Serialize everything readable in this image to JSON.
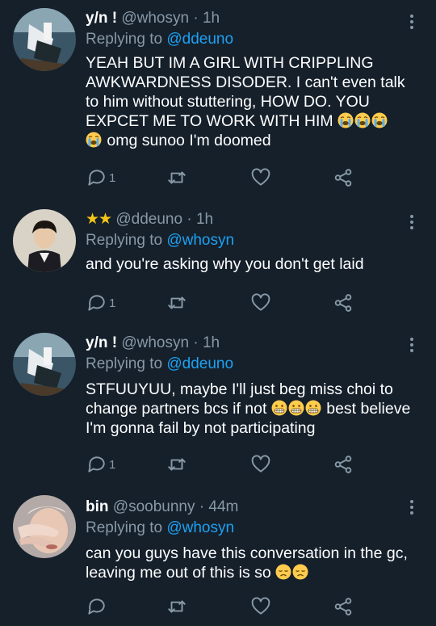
{
  "tweets": [
    {
      "name": "y/n !",
      "handle": "@whosyn",
      "separator": "·",
      "time": "1h",
      "replying_prefix": "Replying to",
      "replying_to": "@ddeuno",
      "text_parts": [
        "YEAH BUT IM A GIRL WITH CRIPPLING AWKWARDNESS DISODER. I can't even talk to him without stuttering, HOW DO. YOU EXPCET ME TO WORK WITH HIM",
        "omg sunoo I'm doomed"
      ],
      "emoji": [
        "loudly-crying-face",
        "loudly-crying-face",
        "loudly-crying-face",
        "loudly-crying-face"
      ],
      "reply_count": "1",
      "icons": {
        "reply": "reply-icon",
        "retweet": "retweet-icon",
        "like": "heart-icon",
        "share": "share-icon",
        "menu": "more-vertical-icon"
      }
    },
    {
      "name_stars": "★★",
      "handle": "@ddeuno",
      "separator": "·",
      "time": "1h",
      "replying_prefix": "Replying to",
      "replying_to": "@whosyn",
      "text_parts": [
        "and you're asking why you don't get laid"
      ],
      "emoji": [],
      "reply_count": "1",
      "icons": {
        "reply": "reply-icon",
        "retweet": "retweet-icon",
        "like": "heart-icon",
        "share": "share-icon",
        "menu": "more-vertical-icon"
      }
    },
    {
      "name": "y/n !",
      "handle": "@whosyn",
      "separator": "·",
      "time": "1h",
      "replying_prefix": "Replying to",
      "replying_to": "@ddeuno",
      "text_parts": [
        "STFUUYUU, maybe I'll just beg miss choi to change partners bcs if not",
        "best believe I'm gonna fail by not participating"
      ],
      "emoji": [
        "grimacing-face",
        "grimacing-face",
        "grimacing-face"
      ],
      "reply_count": "1",
      "icons": {
        "reply": "reply-icon",
        "retweet": "retweet-icon",
        "like": "heart-icon",
        "share": "share-icon",
        "menu": "more-vertical-icon"
      }
    },
    {
      "name": "bin",
      "handle": "@soobunny",
      "separator": "·",
      "time": "44m",
      "replying_prefix": "Replying to",
      "replying_to": "@whosyn",
      "text_parts": [
        "can you guys have this conversation in the gc, leaving me out of this is so"
      ],
      "emoji": [
        "disappointed-face",
        "disappointed-face"
      ],
      "reply_count": "",
      "icons": {
        "reply": "reply-icon",
        "retweet": "retweet-icon",
        "like": "heart-icon",
        "share": "share-icon",
        "menu": "more-vertical-icon"
      }
    }
  ],
  "colors": {
    "background": "#15202b",
    "secondary_text": "#8899a6",
    "link": "#1da1f2",
    "star": "#f5c518"
  }
}
